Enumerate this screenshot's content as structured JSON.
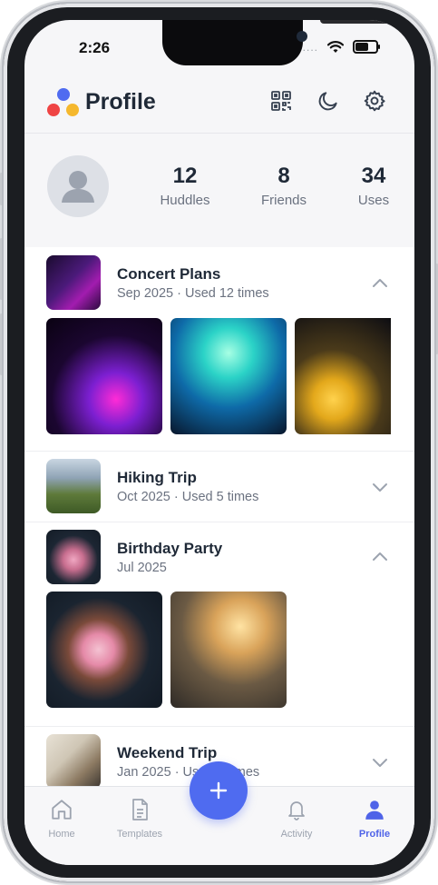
{
  "status_bar": {
    "time": "2:26",
    "signal": "....",
    "battery_level": 0.8
  },
  "header": {
    "title": "Profile",
    "logo_colors": [
      "#4f6bf0",
      "#ef4444",
      "#f5b82e"
    ],
    "actions": [
      {
        "name": "qr-code-icon"
      },
      {
        "name": "moon-icon"
      },
      {
        "name": "gear-icon"
      }
    ]
  },
  "profile": {
    "stats": [
      {
        "value": "12",
        "label": "Huddles"
      },
      {
        "value": "8",
        "label": "Friends"
      },
      {
        "value": "34",
        "label": "Uses"
      }
    ]
  },
  "huddles": [
    {
      "title": "Concert Plans",
      "subtitle": "Sep 2025 · Used 12 times",
      "expanded": true,
      "photos": 3
    },
    {
      "title": "Hiking Trip",
      "subtitle": "Oct 2025 · Used 5 times",
      "expanded": false
    },
    {
      "title": "Birthday Party",
      "subtitle": "Jul 2025",
      "expanded": true,
      "photos": 2
    },
    {
      "title": "Weekend Trip",
      "subtitle": "Jan 2025 · Used 3 times",
      "expanded": false
    }
  ],
  "tabbar": {
    "tabs": [
      {
        "label": "Home",
        "icon": "home-icon"
      },
      {
        "label": "Templates",
        "icon": "document-icon"
      },
      {
        "label": "Activity",
        "icon": "bell-icon"
      },
      {
        "label": "Profile",
        "icon": "user-icon",
        "active": true
      }
    ],
    "fab_icon": "plus-icon"
  },
  "colors": {
    "accent": "#4f6bf0",
    "text": "#1f2937",
    "muted": "#6b7280"
  }
}
